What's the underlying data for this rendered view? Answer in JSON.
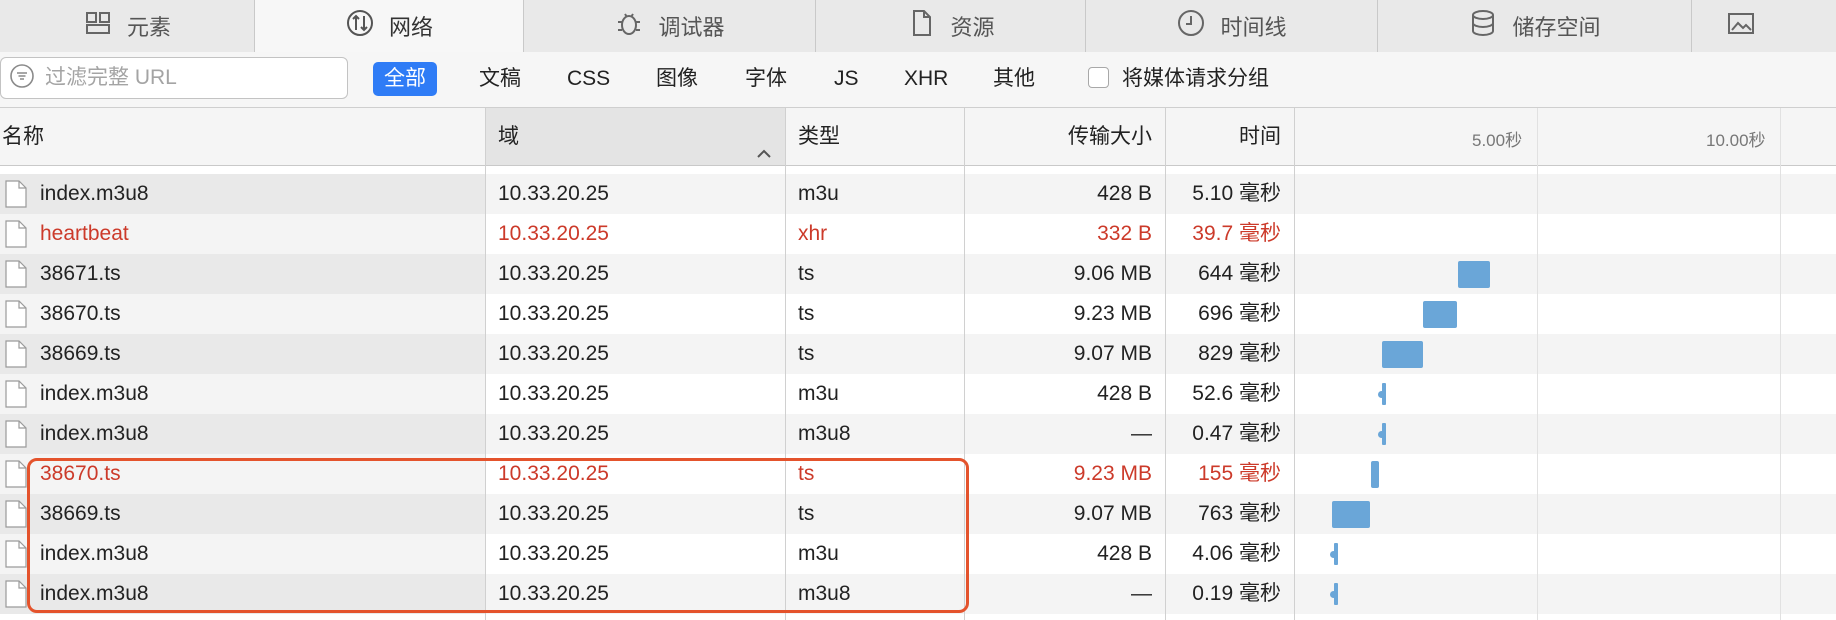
{
  "tabs": [
    {
      "label": "元素",
      "icon": "elements-icon"
    },
    {
      "label": "网络",
      "icon": "network-icon",
      "active": true
    },
    {
      "label": "调试器",
      "icon": "debugger-icon"
    },
    {
      "label": "资源",
      "icon": "resources-icon"
    },
    {
      "label": "时间线",
      "icon": "timeline-icon"
    },
    {
      "label": "储存空间",
      "icon": "storage-icon"
    },
    {
      "label": "",
      "icon": "canvas-icon"
    }
  ],
  "filter": {
    "search_placeholder": "过滤完整 URL",
    "search_value": "",
    "types": [
      "全部",
      "文稿",
      "CSS",
      "图像",
      "字体",
      "JS",
      "XHR",
      "其他"
    ],
    "active_type": "全部",
    "group_media_label": "将媒体请求分组",
    "group_media_checked": false
  },
  "columns": {
    "name": "名称",
    "domain": "域",
    "type": "类型",
    "size": "传输大小",
    "time": "时间",
    "sorted_column": "域",
    "sort_direction": "ascending"
  },
  "waterfall": {
    "ticks": [
      "5.00秒",
      "10.00秒"
    ]
  },
  "colors": {
    "error_text": "#cc3a2a",
    "accent": "#2f7cf6",
    "waterfall_bar": "#6aa6d8",
    "highlight_box": "#e4532c"
  },
  "rows": [
    {
      "name": "index.m3u8",
      "domain": "10.33.20.25",
      "type": "m3u",
      "size": "428 B",
      "time": "5.10 毫秒",
      "error": false
    },
    {
      "name": "heartbeat",
      "domain": "10.33.20.25",
      "type": "xhr",
      "size": "332 B",
      "time": "39.7 毫秒",
      "error": true
    },
    {
      "name": "38671.ts",
      "domain": "10.33.20.25",
      "type": "ts",
      "size": "9.06 MB",
      "time": "644 毫秒",
      "error": false
    },
    {
      "name": "38670.ts",
      "domain": "10.33.20.25",
      "type": "ts",
      "size": "9.23 MB",
      "time": "696 毫秒",
      "error": false
    },
    {
      "name": "38669.ts",
      "domain": "10.33.20.25",
      "type": "ts",
      "size": "9.07 MB",
      "time": "829 毫秒",
      "error": false
    },
    {
      "name": "index.m3u8",
      "domain": "10.33.20.25",
      "type": "m3u",
      "size": "428 B",
      "time": "52.6 毫秒",
      "error": false
    },
    {
      "name": "index.m3u8",
      "domain": "10.33.20.25",
      "type": "m3u8",
      "size": "—",
      "time": "0.47 毫秒",
      "error": false
    },
    {
      "name": "38670.ts",
      "domain": "10.33.20.25",
      "type": "ts",
      "size": "9.23 MB",
      "time": "155 毫秒",
      "error": true
    },
    {
      "name": "38669.ts",
      "domain": "10.33.20.25",
      "type": "ts",
      "size": "9.07 MB",
      "time": "763 毫秒",
      "error": false
    },
    {
      "name": "index.m3u8",
      "domain": "10.33.20.25",
      "type": "m3u",
      "size": "428 B",
      "time": "4.06 毫秒",
      "error": false
    },
    {
      "name": "index.m3u8",
      "domain": "10.33.20.25",
      "type": "m3u8",
      "size": "—",
      "time": "0.19 毫秒",
      "error": false
    }
  ]
}
